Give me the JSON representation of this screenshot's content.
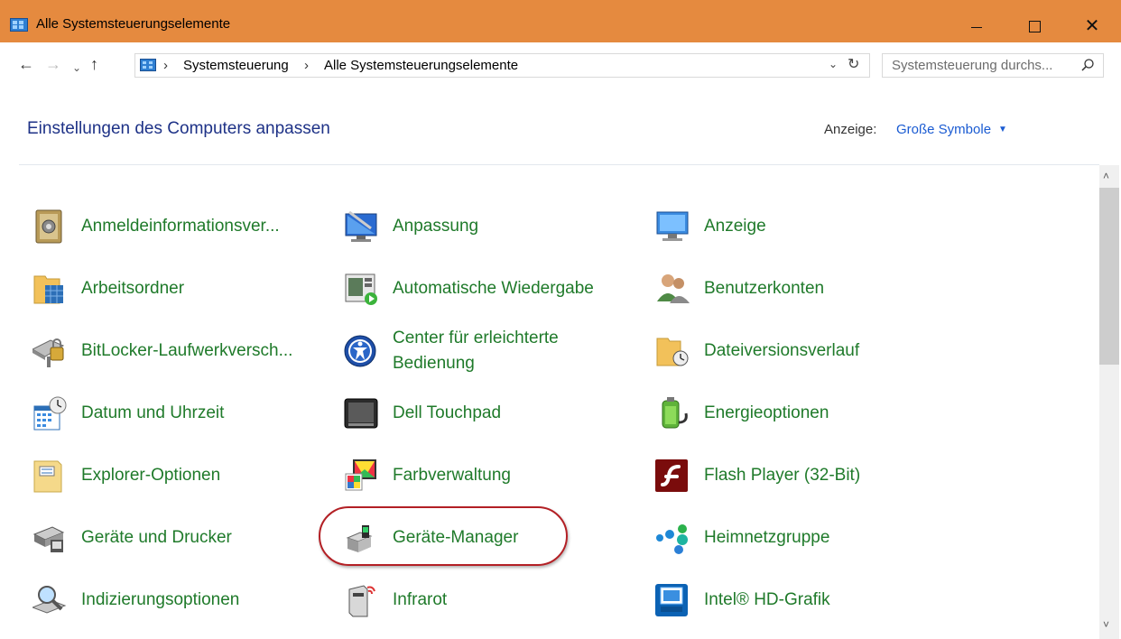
{
  "window": {
    "title": "Alle Systemsteuerungselemente",
    "colors": {
      "titlebar": "#e58a3f",
      "link_green": "#1f7a2a",
      "header_blue": "#1e3287",
      "highlight": "#b32025"
    }
  },
  "titlebar_buttons": {
    "minimize": "—",
    "maximize": "☐",
    "close": "✕"
  },
  "nav": {
    "back": "←",
    "forward": "→",
    "dropdown": "⌄",
    "up": "↑",
    "breadcrumb": [
      {
        "label": "Systemsteuerung"
      },
      {
        "label": "Alle Systemsteuerungselemente"
      }
    ],
    "separator": "›",
    "refresh": "↻",
    "address_dropdown": "⌄"
  },
  "search": {
    "placeholder": "Systemsteuerung durchs..."
  },
  "header": {
    "title": "Einstellungen des Computers anpassen",
    "view_label": "Anzeige:",
    "view_value": "Große Symbole"
  },
  "items": [
    {
      "label": "Anmeldeinformationsver...",
      "icon": "credential-manager-icon"
    },
    {
      "label": "Anpassung",
      "icon": "personalization-icon"
    },
    {
      "label": "Anzeige",
      "icon": "display-icon"
    },
    {
      "label": "Arbeitsordner",
      "icon": "work-folders-icon"
    },
    {
      "label": "Automatische Wiedergabe",
      "icon": "autoplay-icon"
    },
    {
      "label": "Benutzerkonten",
      "icon": "user-accounts-icon"
    },
    {
      "label": "BitLocker-Laufwerkversch...",
      "icon": "bitlocker-icon"
    },
    {
      "label": "Center für erleichterte Bedienung",
      "icon": "ease-of-access-icon"
    },
    {
      "label": "Dateiversionsverlauf",
      "icon": "file-history-icon"
    },
    {
      "label": "Datum und Uhrzeit",
      "icon": "date-time-icon"
    },
    {
      "label": "Dell Touchpad",
      "icon": "touchpad-icon"
    },
    {
      "label": "Energieoptionen",
      "icon": "power-options-icon"
    },
    {
      "label": "Explorer-Optionen",
      "icon": "explorer-options-icon"
    },
    {
      "label": "Farbverwaltung",
      "icon": "color-management-icon"
    },
    {
      "label": "Flash Player (32-Bit)",
      "icon": "flash-player-icon"
    },
    {
      "label": "Geräte und Drucker",
      "icon": "devices-printers-icon"
    },
    {
      "label": "Geräte-Manager",
      "icon": "device-manager-icon",
      "highlighted": true
    },
    {
      "label": "Heimnetzgruppe",
      "icon": "homegroup-icon"
    },
    {
      "label": "Indizierungsoptionen",
      "icon": "indexing-icon"
    },
    {
      "label": "Infrarot",
      "icon": "infrared-icon"
    },
    {
      "label": "Intel® HD-Grafik",
      "icon": "intel-graphics-icon"
    }
  ],
  "scrollbar": {
    "up": "˄",
    "down": "˅"
  }
}
